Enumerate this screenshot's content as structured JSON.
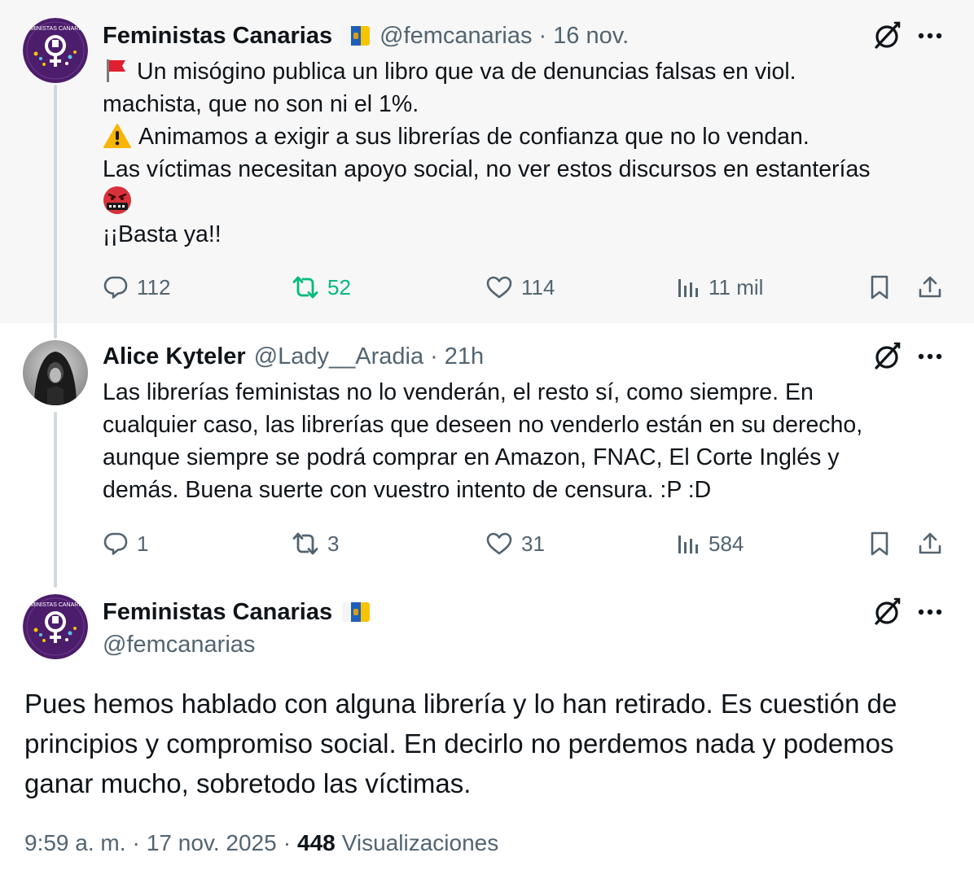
{
  "tweets": [
    {
      "name": "Feministas Canarias",
      "handle": "@femcanarias",
      "time": "16 nov.",
      "avatar_label": "FEMINISTAS CANARIAS",
      "lines": [
        "Un misógino publica un libro que va de denuncias falsas en viol.",
        "machista, que no son ni el 1%.",
        "Animamos a exigir a sus librerías de confianza que no lo vendan.",
        "Las víctimas necesitan apoyo social, no ver estos discursos en estanterías",
        "¡¡Basta ya!!"
      ],
      "replies": "112",
      "reposts": "52",
      "likes": "114",
      "views": "11 mil"
    },
    {
      "name": "Alice Kyteler",
      "handle": "@Lady__Aradia",
      "time": "21h",
      "lines": [
        "Las librerías feministas no lo venderán, el resto sí, como siempre. En",
        "cualquier caso, las librerías que deseen no venderlo están en su derecho,",
        "aunque siempre se podrá comprar en Amazon, FNAC, El Corte Inglés y",
        "demás. Buena suerte con vuestro intento de censura. :P :D"
      ],
      "replies": "1",
      "reposts": "3",
      "likes": "31",
      "views": "584"
    },
    {
      "name": "Feministas Canarias",
      "handle": "@femcanarias",
      "avatar_label": "FEMINISTAS CANARIAS",
      "lines": [
        "Pues hemos hablado con alguna librería y lo han retirado. Es cuestión de",
        "principios y compromiso social. En decirlo no perdemos nada y podemos",
        "ganar mucho, sobretodo las víctimas."
      ],
      "time_full": "9:59 a. m.",
      "date": "17 nov. 2025",
      "views_count": "448",
      "views_label": "Visualizaciones"
    }
  ],
  "separator": "·",
  "icons": [
    "red-flag-icon",
    "warning-icon",
    "swearing-face-icon",
    "canary-islands-flag-icon",
    "grok-icon",
    "more-icon",
    "reply-icon",
    "repost-icon",
    "like-icon",
    "views-icon",
    "bookmark-icon",
    "share-icon"
  ],
  "colors": {
    "background_highlight": "#f7f7f7",
    "text": "#0f1419",
    "secondary": "#536471",
    "repost_active": "#00ba7c",
    "avatar_purple": "#4b1d6b",
    "thread_line": "#cfd9de"
  }
}
